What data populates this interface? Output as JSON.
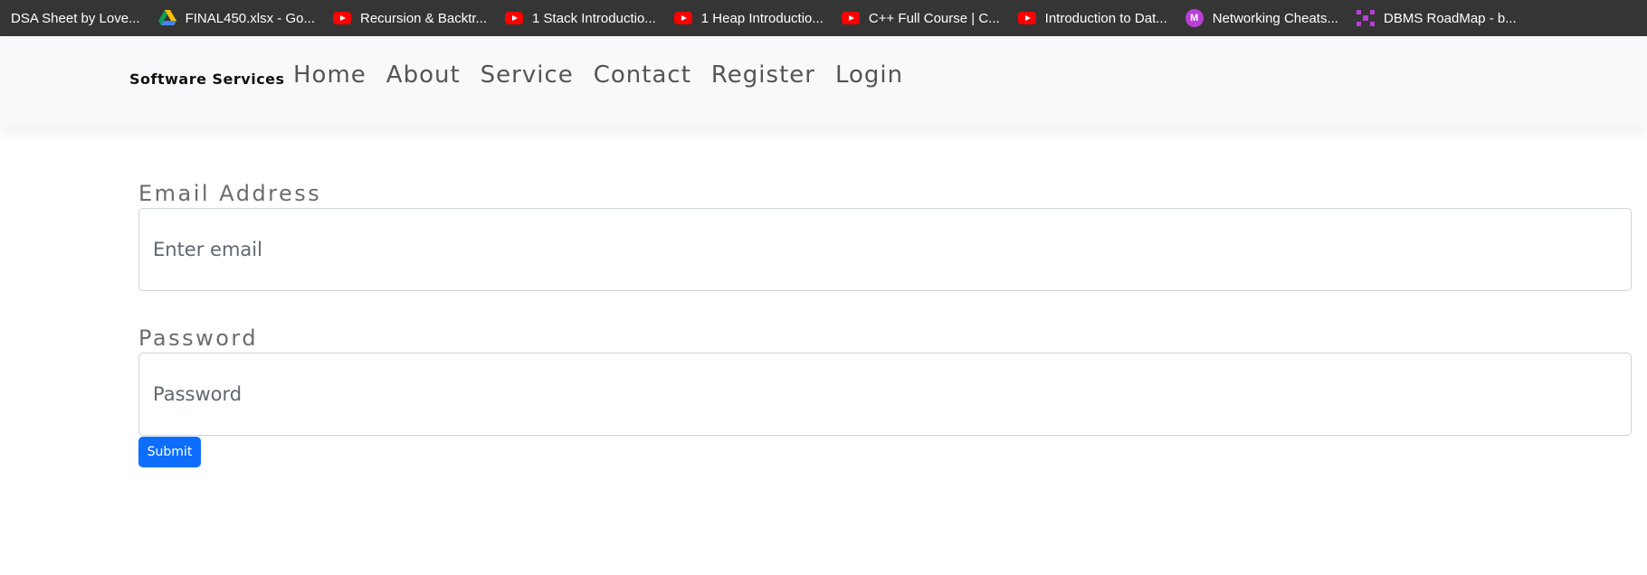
{
  "bookmarks": [
    {
      "label": "DSA Sheet by Love...",
      "icon": "none"
    },
    {
      "label": "FINAL450.xlsx - Go...",
      "icon": "google-drive-icon"
    },
    {
      "label": "Recursion & Backtr...",
      "icon": "youtube-icon"
    },
    {
      "label": "1 Stack Introductio...",
      "icon": "youtube-icon"
    },
    {
      "label": "1 Heap Introductio...",
      "icon": "youtube-icon"
    },
    {
      "label": "C++ Full Course | C...",
      "icon": "youtube-icon"
    },
    {
      "label": "Introduction to Dat...",
      "icon": "youtube-icon"
    },
    {
      "label": "Networking Cheats...",
      "icon": "m-icon"
    },
    {
      "label": "DBMS RoadMap - b...",
      "icon": "roadmap-icon"
    }
  ],
  "navbar": {
    "brand": "Software Services",
    "links": [
      "Home",
      "About",
      "Service",
      "Contact",
      "Register",
      "Login"
    ]
  },
  "form": {
    "email_label": "Email Address",
    "email_placeholder": "Enter email",
    "email_value": "",
    "password_label": "Password",
    "password_placeholder": "Password",
    "password_value": "",
    "submit_label": "Submit"
  },
  "colors": {
    "bookmarks_bg": "#353535",
    "navbar_bg": "#f8f9fa",
    "primary": "#0d6efd",
    "youtube_red": "#ff0000",
    "m_icon_purple": "#b93fd6"
  }
}
